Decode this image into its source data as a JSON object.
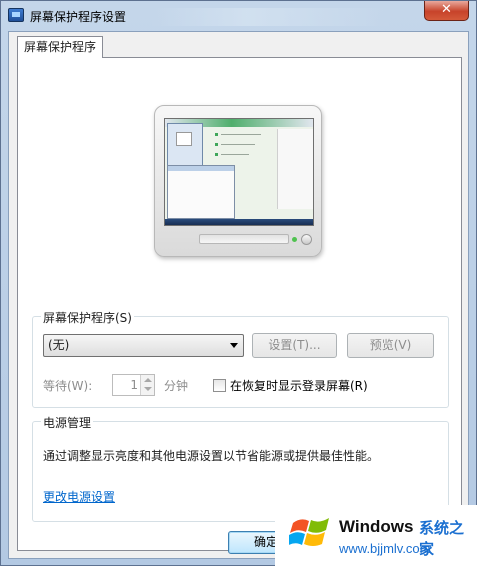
{
  "window": {
    "title": "屏幕保护程序设置",
    "close_label": "✕"
  },
  "tab": {
    "label": "屏幕保护程序"
  },
  "screensaver": {
    "group_label": "屏幕保护程序(S)",
    "selected": "(无)",
    "settings_button": "设置(T)...",
    "preview_button": "预览(V)",
    "wait_label": "等待(W):",
    "wait_value": "1",
    "wait_unit": "分钟",
    "resume_checkbox_label": "在恢复时显示登录屏幕(R)",
    "resume_checked": false
  },
  "power": {
    "group_label": "电源管理",
    "description": "通过调整显示亮度和其他电源设置以节省能源或提供最佳性能。",
    "link": "更改电源设置"
  },
  "footer": {
    "ok_button": "确定"
  },
  "watermark": {
    "brand": "Windows",
    "suffix": "系统之家",
    "url": "www.bjjmlv.com"
  },
  "colors": {
    "link": "#0066cc",
    "close_button": "#c7432a",
    "default_button_border": "#3c7fb1"
  }
}
